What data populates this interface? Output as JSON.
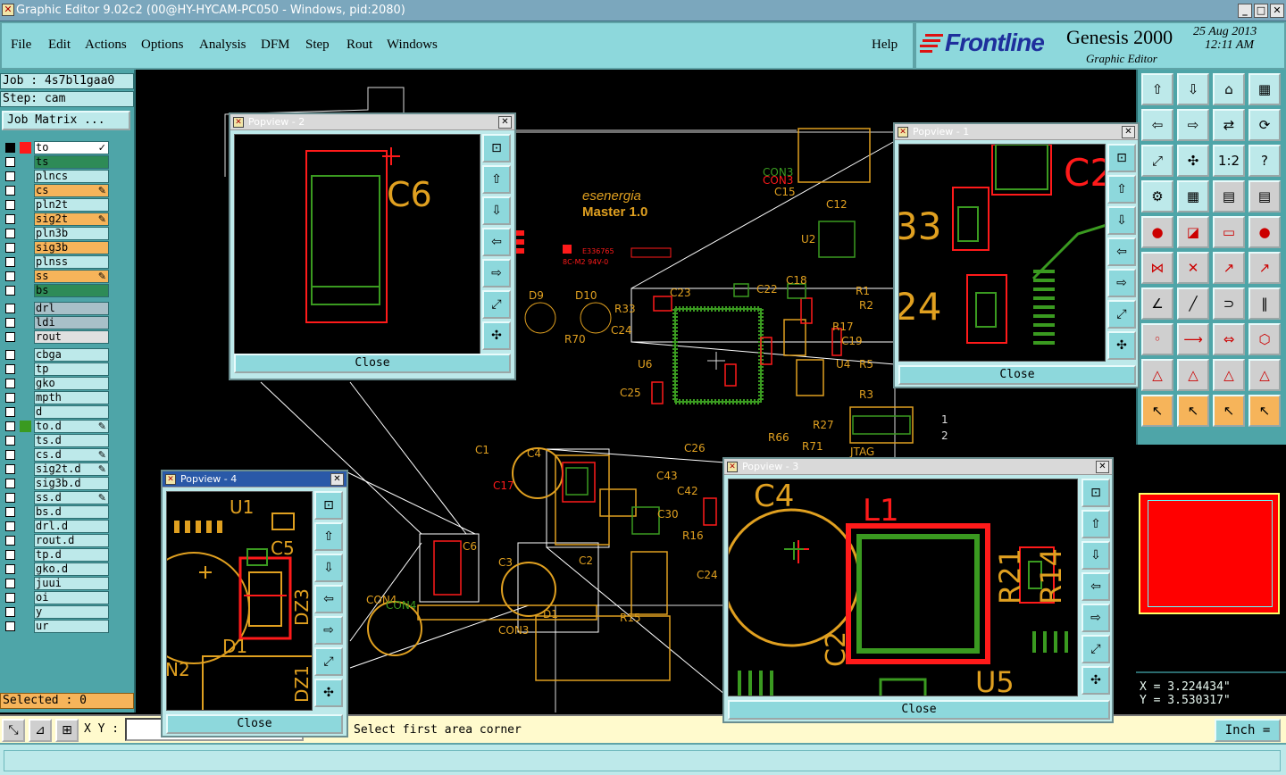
{
  "window": {
    "title": "Graphic Editor 9.02c2 (00@HY-HYCAM-PC050 - Windows, pid:2080)"
  },
  "menu": {
    "items": [
      "File",
      "Edit",
      "Actions",
      "Options",
      "Analysis",
      "DFM",
      "Step",
      "Rout",
      "Windows"
    ],
    "help": "Help"
  },
  "brand": {
    "logo": "Frontline",
    "product": "Genesis 2000",
    "subtitle": "Graphic Editor",
    "date": "25 Aug 2013",
    "time": "12:11 AM"
  },
  "left": {
    "job": "Job : 4s7bl1gaa0",
    "step": "Step: cam",
    "job_matrix": "Job Matrix ...",
    "layers": [
      {
        "name": "to",
        "color": "#ffffff",
        "chk": "filled",
        "edit": "✓"
      },
      {
        "name": "ts",
        "color": "#2e8b57",
        "chk": "",
        "edit": ""
      },
      {
        "name": "plncs",
        "color": "#bde9ea",
        "chk": "",
        "edit": ""
      },
      {
        "name": "cs",
        "color": "#f6b45a",
        "chk": "",
        "edit": "✎"
      },
      {
        "name": "pln2t",
        "color": "#bde9ea",
        "chk": "",
        "edit": ""
      },
      {
        "name": "sig2t",
        "color": "#f6b45a",
        "chk": "",
        "edit": "✎"
      },
      {
        "name": "pln3b",
        "color": "#bde9ea",
        "chk": "",
        "edit": ""
      },
      {
        "name": "sig3b",
        "color": "#f6b45a",
        "chk": "",
        "edit": ""
      },
      {
        "name": "plnss",
        "color": "#bde9ea",
        "chk": "",
        "edit": ""
      },
      {
        "name": "ss",
        "color": "#f6b45a",
        "chk": "",
        "edit": "✎"
      },
      {
        "name": "bs",
        "color": "#2e8b57",
        "chk": "",
        "edit": ""
      },
      {
        "name": "drl",
        "color": "#a8c0c8",
        "chk": "",
        "edit": ""
      },
      {
        "name": "ldi",
        "color": "#a8c0c8",
        "chk": "",
        "edit": ""
      },
      {
        "name": "rout",
        "color": "#e0e0e0",
        "chk": "",
        "edit": ""
      },
      {
        "name": "cbga",
        "color": "#bde9ea",
        "chk": "",
        "edit": ""
      },
      {
        "name": "tp",
        "color": "#bde9ea",
        "chk": "",
        "edit": ""
      },
      {
        "name": "gko",
        "color": "#bde9ea",
        "chk": "",
        "edit": ""
      },
      {
        "name": "mpth",
        "color": "#bde9ea",
        "chk": "",
        "edit": ""
      },
      {
        "name": "d",
        "color": "#bde9ea",
        "chk": "",
        "edit": ""
      },
      {
        "name": "to.d",
        "color": "#bde9ea",
        "chk": "",
        "edit": "✎"
      },
      {
        "name": "ts.d",
        "color": "#bde9ea",
        "chk": "",
        "edit": ""
      },
      {
        "name": "cs.d",
        "color": "#bde9ea",
        "chk": "",
        "edit": "✎"
      },
      {
        "name": "sig2t.d",
        "color": "#bde9ea",
        "chk": "",
        "edit": "✎"
      },
      {
        "name": "sig3b.d",
        "color": "#bde9ea",
        "chk": "",
        "edit": ""
      },
      {
        "name": "ss.d",
        "color": "#bde9ea",
        "chk": "",
        "edit": "✎"
      },
      {
        "name": "bs.d",
        "color": "#bde9ea",
        "chk": "",
        "edit": ""
      },
      {
        "name": "drl.d",
        "color": "#bde9ea",
        "chk": "",
        "edit": ""
      },
      {
        "name": "rout.d",
        "color": "#bde9ea",
        "chk": "",
        "edit": ""
      },
      {
        "name": "tp.d",
        "color": "#bde9ea",
        "chk": "",
        "edit": ""
      },
      {
        "name": "gko.d",
        "color": "#bde9ea",
        "chk": "",
        "edit": ""
      },
      {
        "name": "juui",
        "color": "#bde9ea",
        "chk": "",
        "edit": ""
      },
      {
        "name": "oi",
        "color": "#bde9ea",
        "chk": "",
        "edit": ""
      },
      {
        "name": "y",
        "color": "#bde9ea",
        "chk": "",
        "edit": ""
      },
      {
        "name": "ur",
        "color": "#bde9ea",
        "chk": "",
        "edit": ""
      }
    ],
    "selected": "Selected : 0"
  },
  "bottom": {
    "xy_label": "X Y :",
    "xy_value": "",
    "prompt": "Select first area corner",
    "units": "Inch ="
  },
  "coords": {
    "x": "X = 3.224434\"",
    "y": "Y = 3.530317\""
  },
  "pcb_labels": {
    "brand1": "esenergia",
    "brand2": "Master 1.0",
    "cert": "E336765",
    "cert2": "8C-M2 94V-0"
  },
  "popviews": [
    {
      "title": "Popview - 2",
      "close": "Close",
      "label": "C6"
    },
    {
      "title": "Popview - 1",
      "close": "Close",
      "label1": "C2",
      "label2": "33",
      "label3": "24"
    },
    {
      "title": "Popview - 3",
      "close": "Close",
      "label1": "C4",
      "label2": "L1",
      "label3": "R21",
      "label4": "R14",
      "label5": "C2",
      "label6": "U5"
    },
    {
      "title": "Popview - 4",
      "close": "Close",
      "label1": "U1",
      "label2": "C5",
      "label3": "DZ3",
      "label4": "DZ1",
      "label5": "D1",
      "label6": "N2"
    }
  ],
  "colors": {
    "panel": "#4ea5a8",
    "menu": "#8dd8dc",
    "copper_red": "#ff1a1a",
    "silk_yellow": "#e0a020",
    "comp_green": "#3a9a20"
  }
}
